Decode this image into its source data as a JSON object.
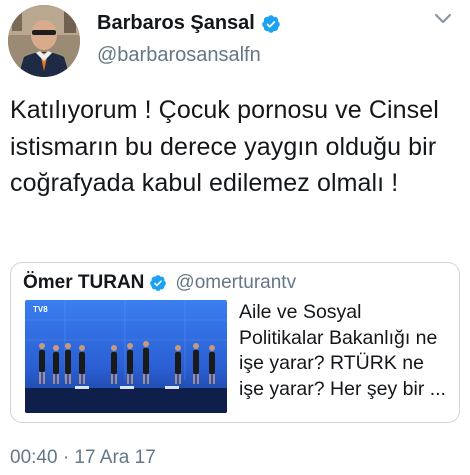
{
  "tweet": {
    "author_name": "Barbaros Şansal",
    "author_handle": "@barbarosansalfn",
    "text": "Katılıyorum ! Çocuk pornosu ve Cinsel istismarın bu derece yaygın olduğu bir coğrafyada kabul edilemez olmalı !",
    "timestamp": "00:40 · 17 Ara 17",
    "verified": true
  },
  "quoted_tweet": {
    "author_name": "Ömer TURAN",
    "author_handle": "@omerturantv",
    "text": "Aile ve Sosyal Politikalar Bakanlığı ne işe yarar? RTÜRK ne işe yarar? Her şey bir ...",
    "verified": true
  },
  "icons": {
    "verified": "verified-badge-icon",
    "more": "chevron-down-icon"
  },
  "colors": {
    "verified_blue": "#1da1f2",
    "secondary_text": "#657786",
    "border": "#ccd6dd",
    "stage_blue": "#2b5fd6"
  }
}
